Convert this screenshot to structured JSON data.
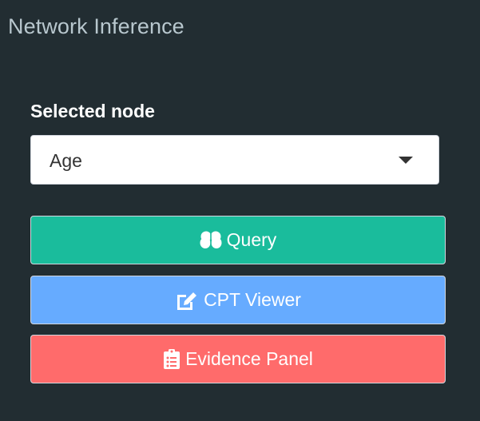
{
  "panel": {
    "title": "Network Inference"
  },
  "node_select": {
    "label": "Selected node",
    "value": "Age"
  },
  "buttons": {
    "query": {
      "label": "Query",
      "icon": "brain-icon",
      "color": "#1abc9c"
    },
    "cpt_viewer": {
      "label": "CPT Viewer",
      "icon": "edit-icon",
      "color": "#66abff"
    },
    "evidence_panel": {
      "label": "Evidence Panel",
      "icon": "clipboard-list-icon",
      "color": "#ff6b6b"
    }
  },
  "colors": {
    "background": "#222d32",
    "title_text": "#b8c7ce"
  }
}
